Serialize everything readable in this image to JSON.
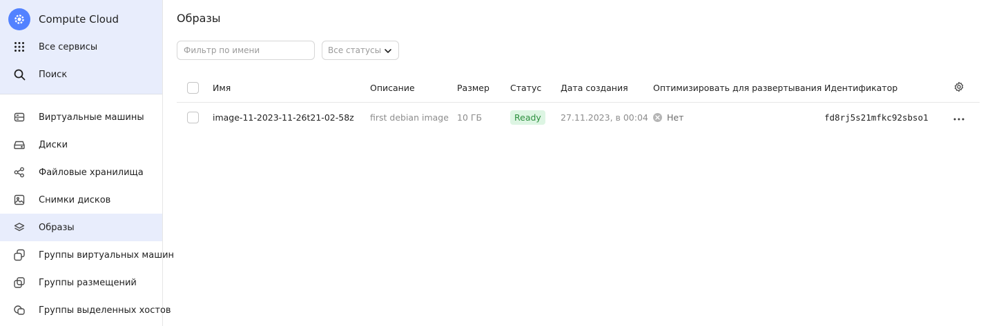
{
  "sidebar": {
    "brand": {
      "label": "Compute Cloud",
      "icon": "gear-icon"
    },
    "top_items": [
      {
        "label": "Все сервисы",
        "icon": "grid-icon"
      },
      {
        "label": "Поиск",
        "icon": "search-icon"
      }
    ],
    "items": [
      {
        "label": "Виртуальные машины",
        "icon": "server-icon"
      },
      {
        "label": "Диски",
        "icon": "disk-icon"
      },
      {
        "label": "Файловые хранилища",
        "icon": "share-icon"
      },
      {
        "label": "Снимки дисков",
        "icon": "image-icon"
      },
      {
        "label": "Образы",
        "icon": "layers-icon",
        "active": true
      },
      {
        "label": "Группы виртуальных машин",
        "icon": "vm-group-icon"
      },
      {
        "label": "Группы размещений",
        "icon": "placement-icon"
      },
      {
        "label": "Группы выделенных хостов",
        "icon": "hosts-icon"
      }
    ]
  },
  "main": {
    "title": "Образы",
    "filter": {
      "placeholder": "Фильтр по имени",
      "value": ""
    },
    "status_select": {
      "value": "Все статусы"
    },
    "table": {
      "columns": [
        "Имя",
        "Описание",
        "Размер",
        "Статус",
        "Дата создания",
        "Оптимизировать для развертывания",
        "Идентификатор"
      ],
      "rows": [
        {
          "name": "image-11-2023-11-26t21-02-58z",
          "description": "first debian image",
          "size": "10 ГБ",
          "status": "Ready",
          "created": "27.11.2023, в 00:04",
          "optimize": "Нет",
          "id": "fd8rj5s21mfkc92sbso1"
        }
      ]
    }
  },
  "colors": {
    "accent": "#5282ff",
    "sidebar_highlight": "#e8edfc",
    "status_ready_bg": "#ddf5e3",
    "status_ready_text": "#2d8f3e"
  }
}
